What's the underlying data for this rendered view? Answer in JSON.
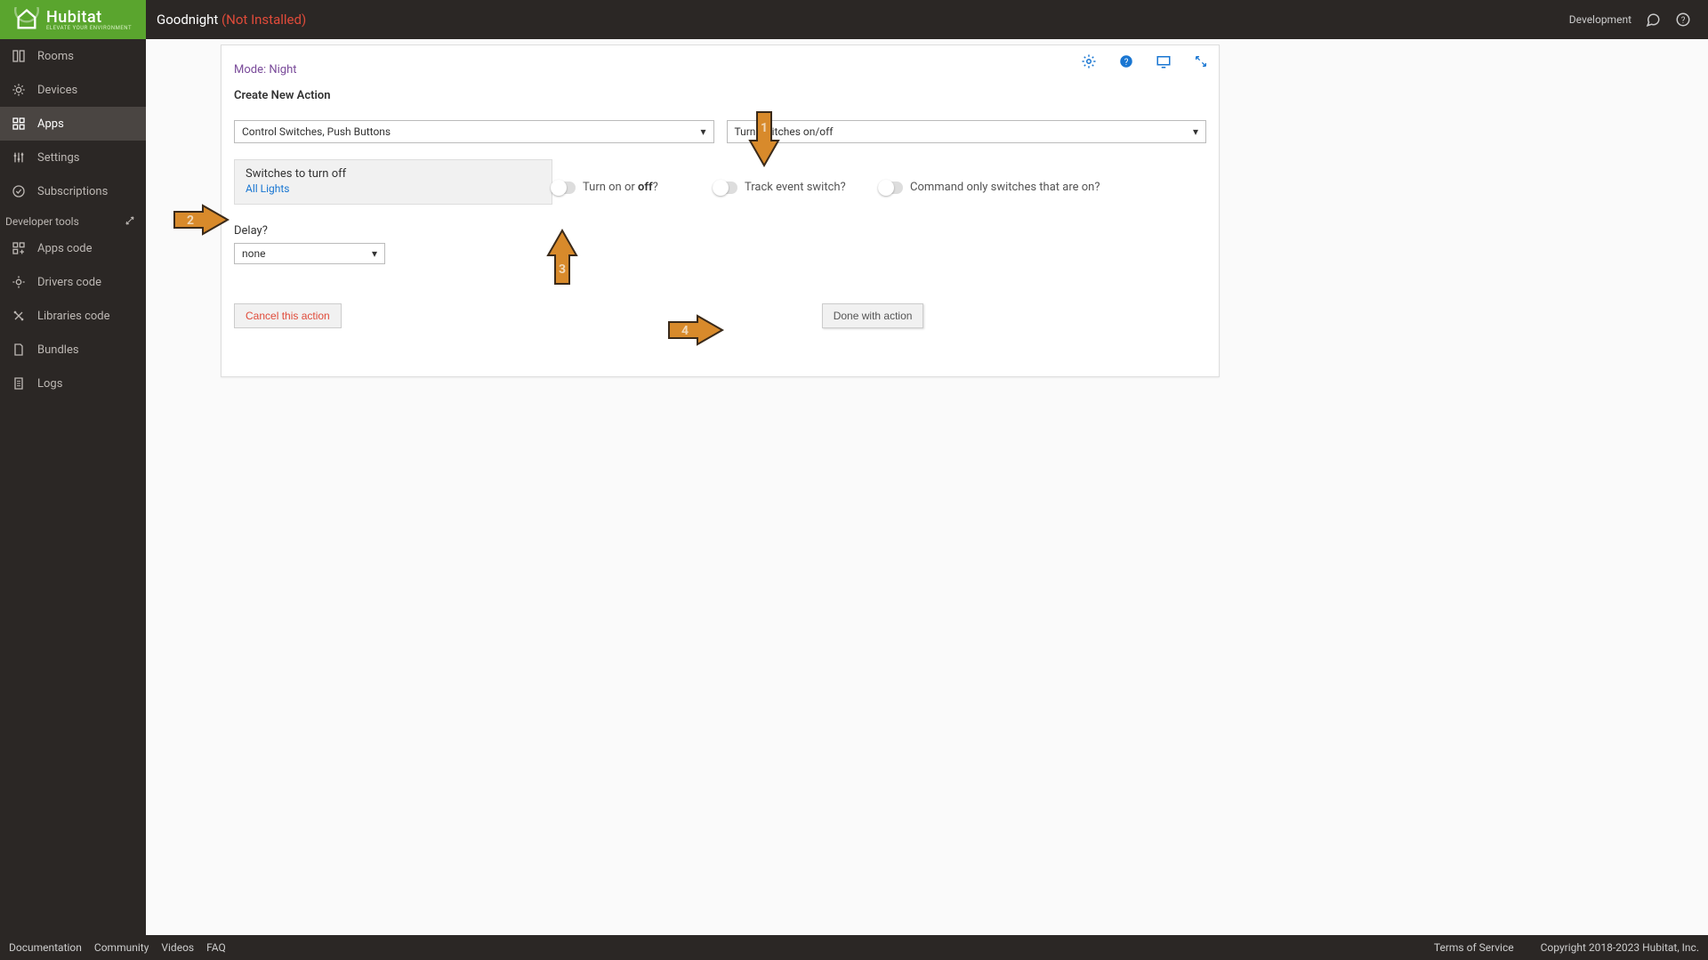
{
  "header": {
    "brand": "Hubitat",
    "brand_tagline": "ELEVATE YOUR ENVIRONMENT",
    "title": "Goodnight",
    "status": "(Not Installed)",
    "env_label": "Development"
  },
  "sidebar": {
    "main": [
      {
        "label": "Rooms"
      },
      {
        "label": "Devices"
      },
      {
        "label": "Apps"
      },
      {
        "label": "Settings"
      },
      {
        "label": "Subscriptions"
      }
    ],
    "dev_section": "Developer tools",
    "dev": [
      {
        "label": "Apps code"
      },
      {
        "label": "Drivers code"
      },
      {
        "label": "Libraries code"
      },
      {
        "label": "Bundles"
      },
      {
        "label": "Logs"
      }
    ]
  },
  "card": {
    "mode": "Mode: Night",
    "heading": "Create New Action",
    "dropdown1": "Control Switches, Push Buttons",
    "dropdown2": "Turn switches on/off",
    "switches_label": "Switches to turn off",
    "switches_value": "All Lights",
    "toggle1_prefix": "Turn on or ",
    "toggle1_bold": "off",
    "toggle1_suffix": "?",
    "toggle2": "Track event switch?",
    "toggle3": "Command only switches that are on?",
    "delay_label": "Delay?",
    "delay_value": "none",
    "cancel": "Cancel this action",
    "done": "Done with action"
  },
  "footer": {
    "links": [
      "Documentation",
      "Community",
      "Videos",
      "FAQ"
    ],
    "tos": "Terms of Service",
    "copyright": "Copyright 2018-2023 Hubitat, Inc."
  },
  "annotations": {
    "a1": "1",
    "a2": "2",
    "a3": "3",
    "a4": "4"
  }
}
